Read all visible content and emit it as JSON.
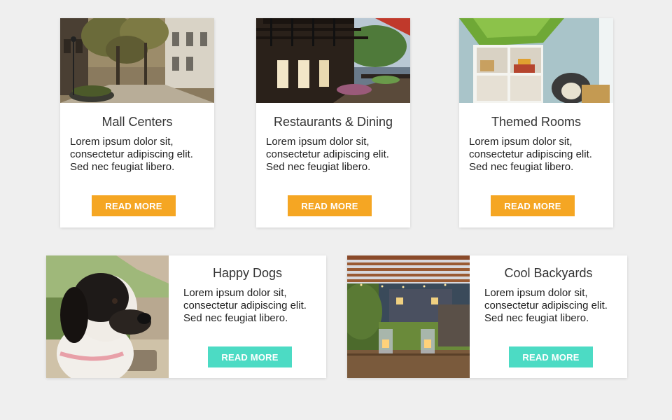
{
  "colors": {
    "background": "#efefef",
    "card": "#ffffff",
    "orange_button": "#f5a623",
    "teal_button": "#4cdbc4"
  },
  "top_cards": [
    {
      "title": "Mall Centers",
      "body": "Lorem ipsum dolor sit, consectetur adipiscing elit. Sed nec feugiat libero.",
      "button": "READ MORE",
      "image": "mall-street-photo"
    },
    {
      "title": "Restaurants & Dining",
      "body": "Lorem ipsum dolor sit, consectetur adipiscing elit. Sed nec feugiat libero.",
      "button": "READ MORE",
      "image": "restaurant-patio-photo"
    },
    {
      "title": "Themed Rooms",
      "body": "Lorem ipsum dolor sit, consectetur adipiscing elit. Sed nec feugiat libero.",
      "button": "READ MORE",
      "image": "kids-room-photo"
    }
  ],
  "bottom_cards": [
    {
      "title": "Happy Dogs",
      "body": "Lorem ipsum dolor sit, consectetur adipiscing elit. Sed nec feugiat libero.",
      "button": "READ MORE",
      "image": "dog-in-car-photo"
    },
    {
      "title": "Cool Backyards",
      "body": "Lorem ipsum dolor sit, consectetur adipiscing elit. Sed nec feugiat libero.",
      "button": "READ MORE",
      "image": "backyard-pergola-photo"
    }
  ]
}
